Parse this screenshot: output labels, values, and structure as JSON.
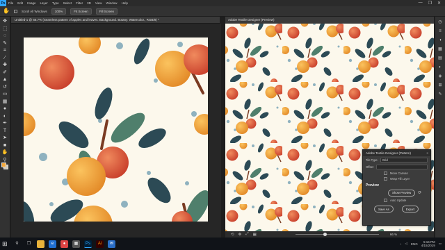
{
  "menubar": {
    "logo": "Ps",
    "items": [
      "File",
      "Edit",
      "Image",
      "Layer",
      "Type",
      "Select",
      "Filter",
      "3D",
      "View",
      "Window",
      "Help"
    ],
    "controls": [
      "—",
      "❐",
      "✕"
    ]
  },
  "options": {
    "scroll_all_windows": "Scroll All Windows",
    "zoom_value": "100%",
    "fit_screen": "Fit Screen",
    "fill_screen": "Fill Screen"
  },
  "document": {
    "tab_title": "Untitled-1 @ 66.7% (Seamless pattern of apples and leaves. Background. Botany. Watercolor., RGB/8) *"
  },
  "preview": {
    "tab_title": "Adobe Textile Designer (Preview)",
    "zoom": "66 %"
  },
  "textile_panel": {
    "title": "Adobe Textile Designer (Pattern)",
    "tile_type_label": "Tile Type",
    "tile_type_value": "Grid",
    "offset_label": "Offset",
    "offset_value": "",
    "move_canvas_label": "Move Canvas",
    "wrap_fill_layer_label": "Wrap Fill Layer",
    "preview_section": "Preview",
    "show_preview_btn": "Show Preview",
    "auto_update_label": "Auto Update",
    "save_as_btn": "Save As",
    "export_btn": "Export"
  },
  "taskbar": {
    "language": "ENG",
    "time": "5:16 PM",
    "date": "4/15/2019"
  },
  "colors": {
    "canvas_bg": "#fcf8ec",
    "apple_red": "#e0553b",
    "apple_orange": "#f2a43a",
    "leaf_dark": "#2c4a55",
    "leaf_green": "#4f7f6c",
    "stem": "#7a3b22",
    "dot": "#8fb2bf"
  },
  "icons": {
    "toolbar": [
      "move-icon",
      "marquee-icon",
      "lasso-icon",
      "quick-select-icon",
      "crop-icon",
      "eyedropper-icon",
      "healing-icon",
      "brush-icon",
      "stamp-icon",
      "history-brush-icon",
      "eraser-icon",
      "gradient-icon",
      "blur-icon",
      "dodge-icon",
      "pen-icon",
      "type-icon",
      "path-select-icon",
      "shape-icon",
      "hand-icon",
      "zoom-icon",
      "more-icon"
    ],
    "right_strip": [
      "history-icon",
      "properties-icon",
      "color-icon",
      "swatches-icon",
      "libraries-icon",
      "adjustments-icon",
      "layers-icon",
      "channels-icon",
      "paths-icon"
    ]
  }
}
